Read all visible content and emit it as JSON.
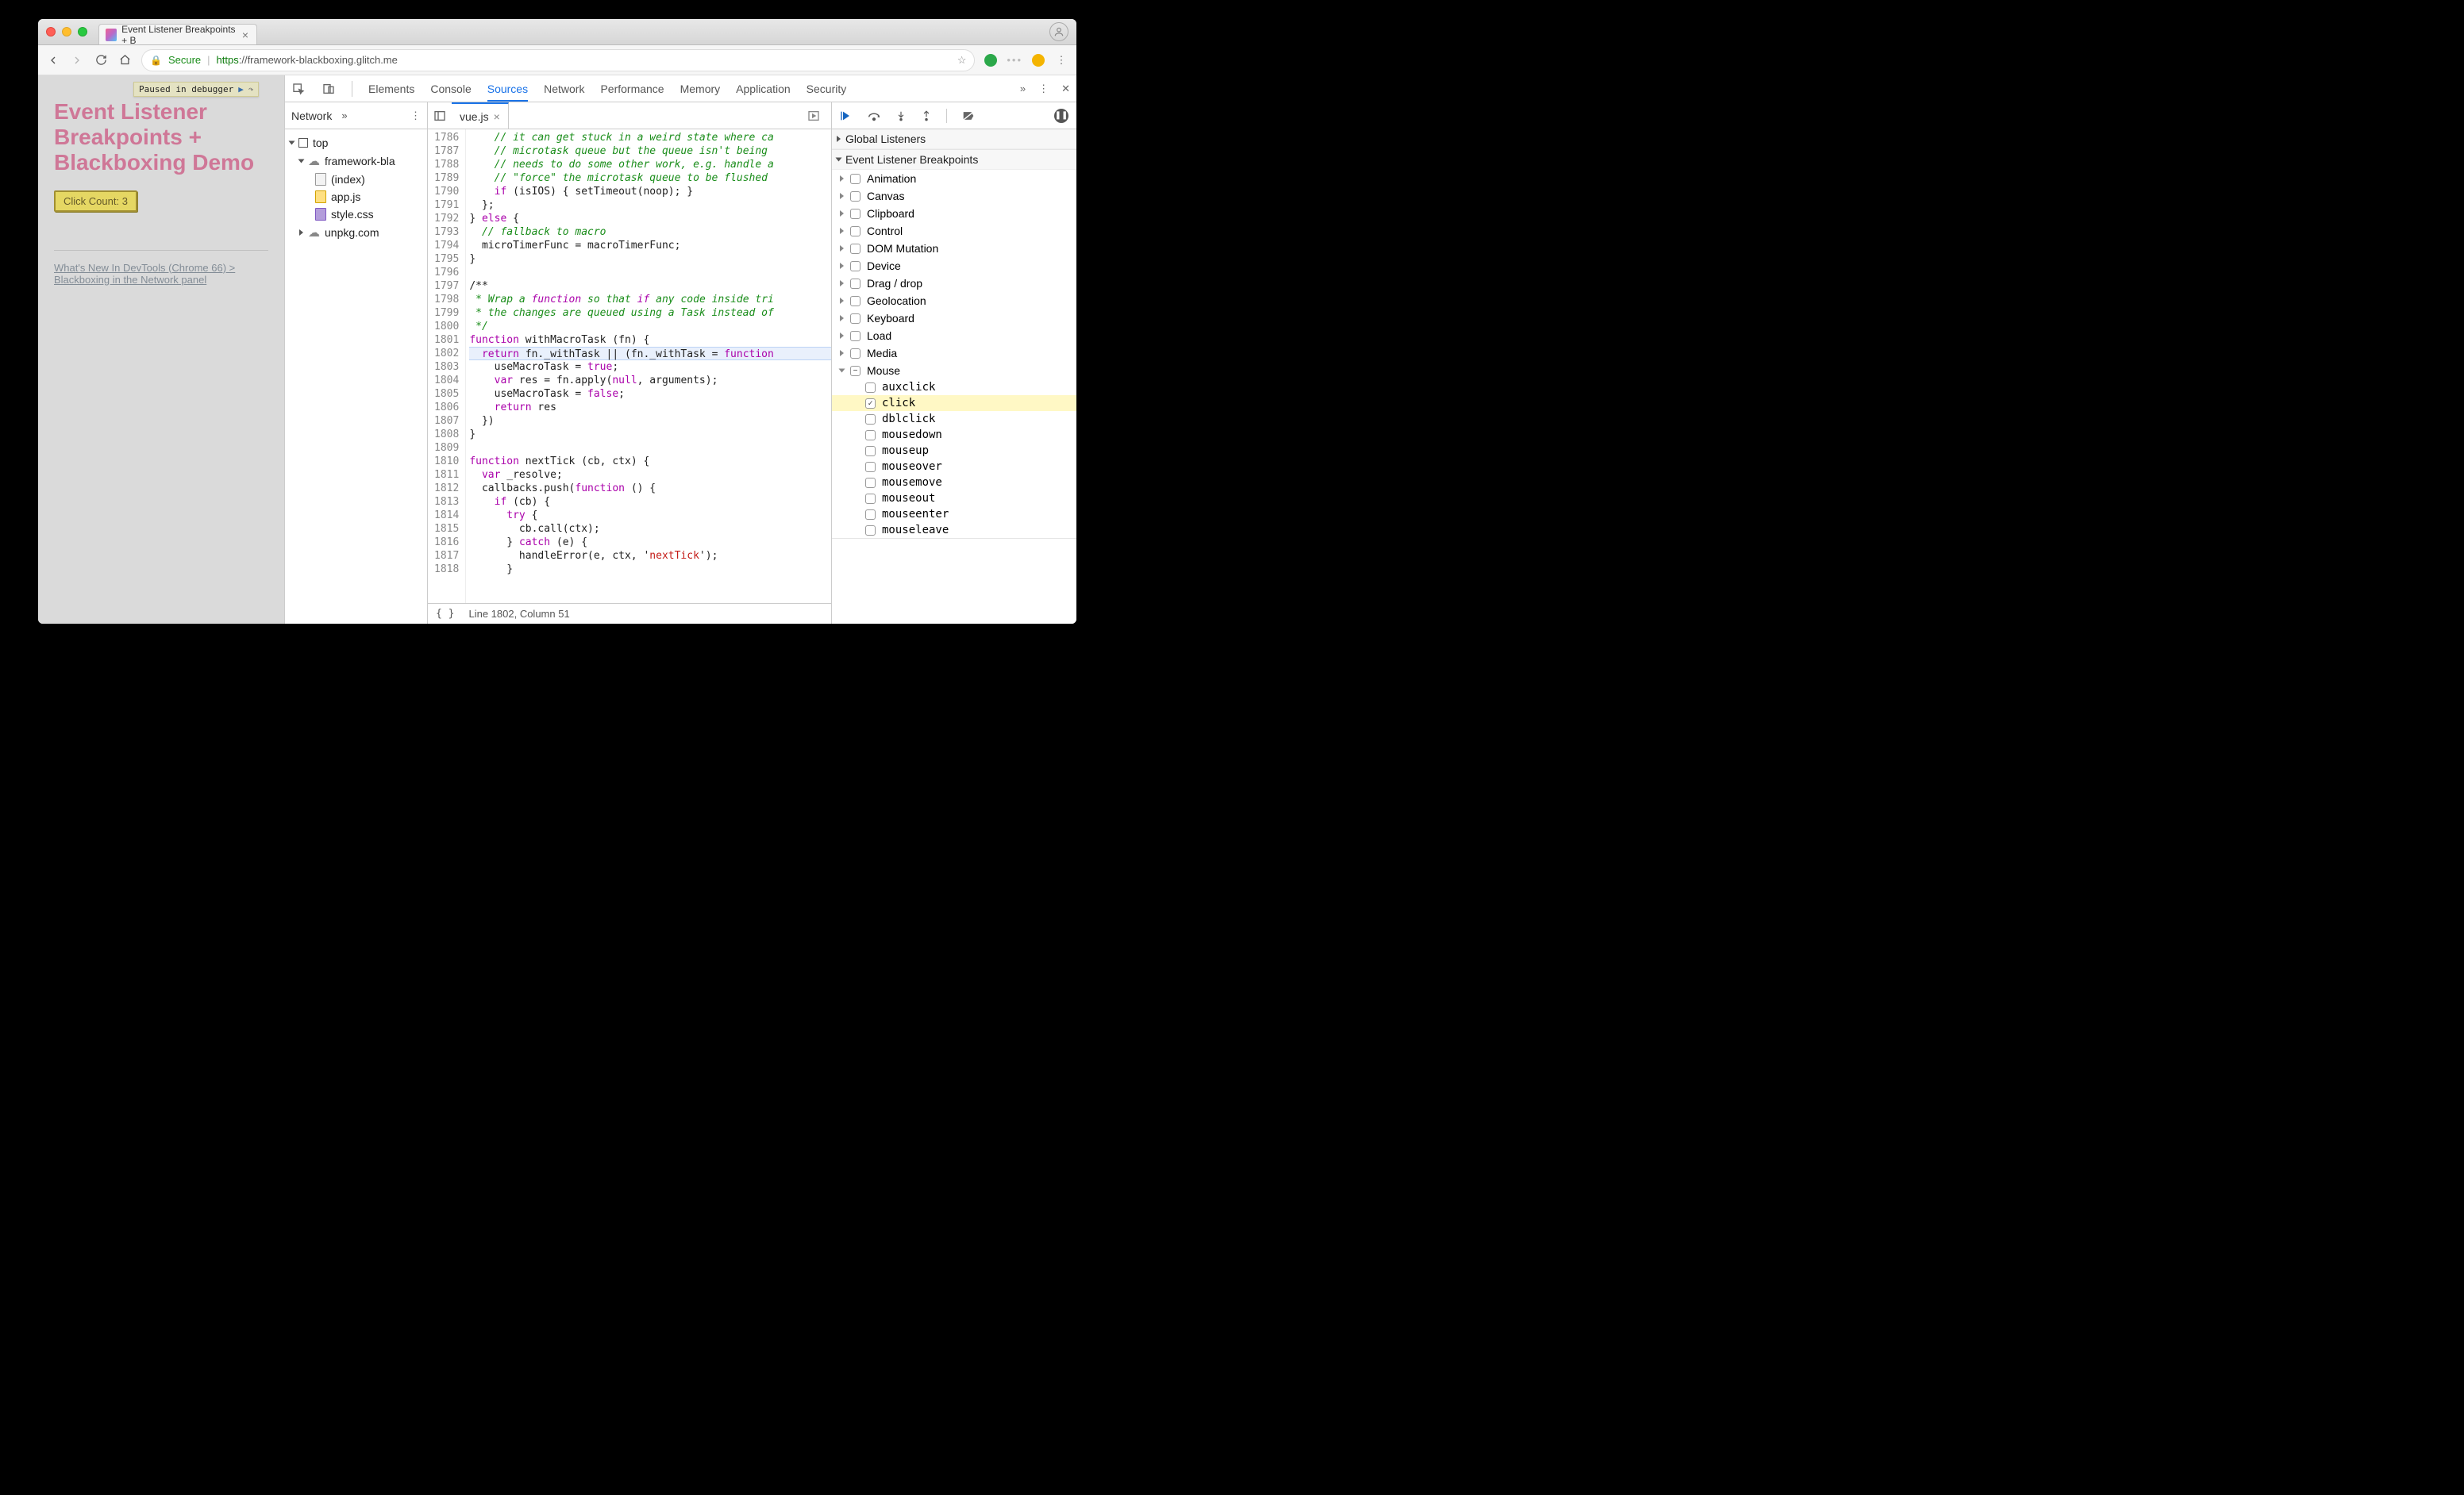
{
  "tab": {
    "title": "Event Listener Breakpoints + B"
  },
  "url": {
    "secure": "Secure",
    "full": "https://framework-blackboxing.glitch.me",
    "proto": "https",
    "host_path": "://framework-blackboxing.glitch.me"
  },
  "page": {
    "paused": "Paused in debugger",
    "h1_l1": "Event Listener",
    "h1_l2": "Breakpoints +",
    "h1_l3": "Blackboxing Demo",
    "click_btn": "Click Count: 3",
    "link": "What's New In DevTools (Chrome 66) > Blackboxing in the Network panel"
  },
  "dtTabs": {
    "elements": "Elements",
    "console": "Console",
    "sources": "Sources",
    "network": "Network",
    "performance": "Performance",
    "memory": "Memory",
    "application": "Application",
    "security": "Security"
  },
  "leftNav": {
    "network": "Network",
    "top": "top",
    "framework": "framework-bla",
    "index": "(index)",
    "appjs": "app.js",
    "stylecss": "style.css",
    "unpkg": "unpkg.com"
  },
  "editor": {
    "file": "vue.js",
    "gutterStart": 1786,
    "lines": [
      "    // it can get stuck in a weird state where ca",
      "    // microtask queue but the queue isn't being ",
      "    // needs to do some other work, e.g. handle a",
      "    // \"force\" the microtask queue to be flushed ",
      "    if (isIOS) { setTimeout(noop); }",
      "  };",
      "} else {",
      "  // fallback to macro",
      "  microTimerFunc = macroTimerFunc;",
      "}",
      "",
      "/**",
      " * Wrap a function so that if any code inside tri",
      " * the changes are queued using a Task instead of",
      " */",
      "function withMacroTask (fn) {",
      "  return fn._withTask || (fn._withTask = function",
      "    useMacroTask = true;",
      "    var res = fn.apply(null, arguments);",
      "    useMacroTask = false;",
      "    return res",
      "  })",
      "} ",
      "",
      "function nextTick (cb, ctx) {",
      "  var _resolve;",
      "  callbacks.push(function () {",
      "    if (cb) {",
      "      try {",
      "        cb.call(ctx);",
      "      } catch (e) {",
      "        handleError(e, ctx, 'nextTick');",
      "      }"
    ],
    "highlight": 1802,
    "status": "Line 1802, Column 51"
  },
  "rpanel": {
    "global": "Global Listeners",
    "elb": "Event Listener Breakpoints",
    "cats": [
      "Animation",
      "Canvas",
      "Clipboard",
      "Control",
      "DOM Mutation",
      "Device",
      "Drag / drop",
      "Geolocation",
      "Keyboard",
      "Load",
      "Media",
      "Mouse"
    ],
    "mouseEvents": [
      "auxclick",
      "click",
      "dblclick",
      "mousedown",
      "mouseup",
      "mouseover",
      "mousemove",
      "mouseout",
      "mouseenter",
      "mouseleave"
    ],
    "checked": "click"
  }
}
